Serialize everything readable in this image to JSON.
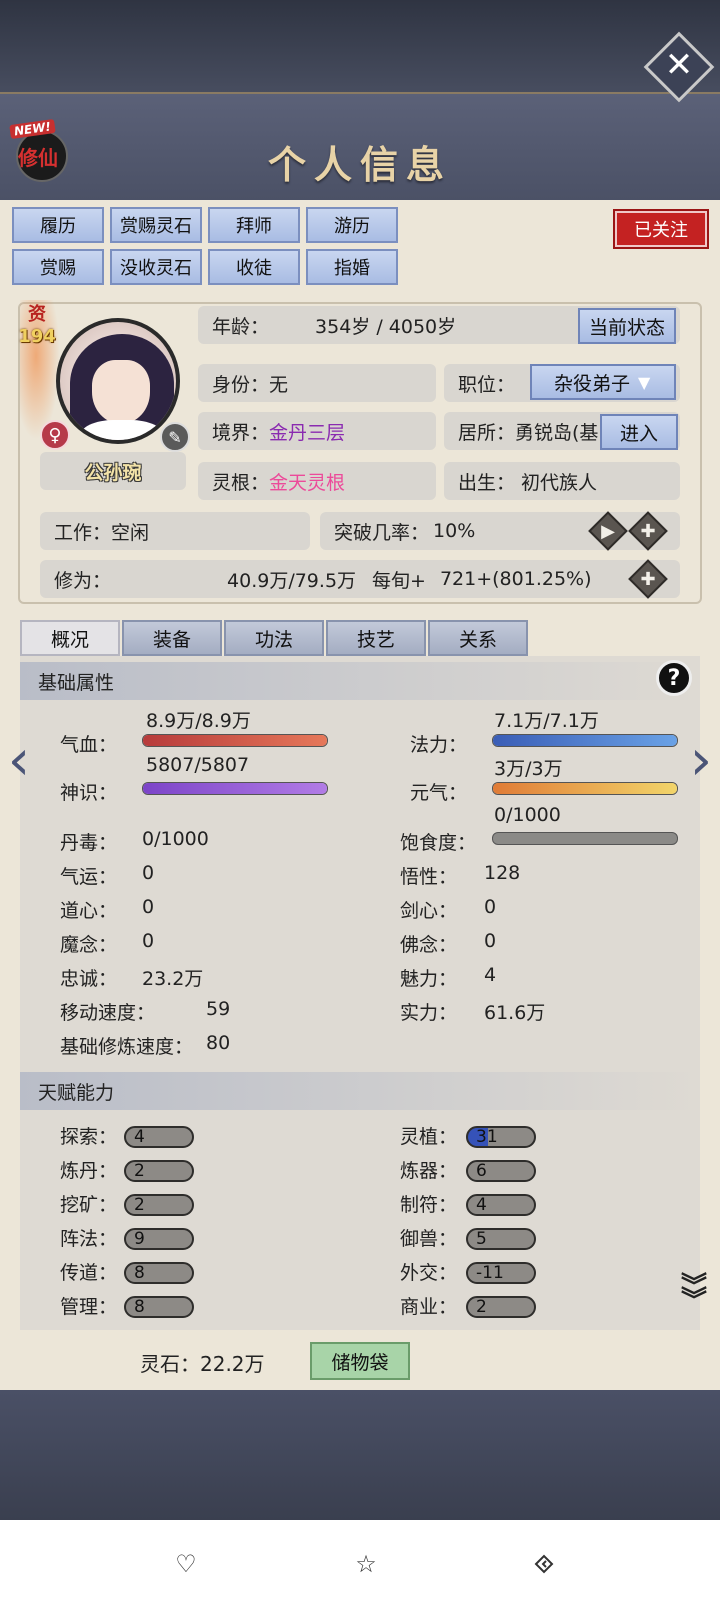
{
  "header": {
    "title": "个人信息",
    "logo_new": "NEW!",
    "logo_text": "修仙",
    "close_glyph": "✕"
  },
  "actions": {
    "row1": [
      "履历",
      "赏赐灵石",
      "拜师",
      "游历"
    ],
    "row2": [
      "赏赐",
      "没收灵石",
      "收徒",
      "指婚"
    ],
    "follow": "已关注"
  },
  "profile": {
    "aptitude_label": "资",
    "aptitude_value": "194",
    "name": "公孙琬",
    "gender_icon": "female-icon",
    "age_label": "年龄：",
    "age_value": "354岁 / 4050岁",
    "status_button": "当前状态",
    "identity_label": "身份：",
    "identity_value": "无",
    "position_label": "职位：",
    "position_value": "杂役弟子",
    "realm_label": "境界：",
    "realm_value": "金丹三层",
    "residence_label": "居所：",
    "residence_value": "勇锐岛(基",
    "enter_button": "进入",
    "root_label": "灵根：",
    "root_value": "金天灵根",
    "birth_label": "出生：",
    "birth_value": "初代族人",
    "work_label": "工作：",
    "work_value": "空闲",
    "breakthrough_label": "突破几率：",
    "breakthrough_value": "10%",
    "cultivation_label": "修为：",
    "cultivation_value": "40.9万/79.5万",
    "per_xun_label": "每旬+",
    "per_xun_value": "721+(801.25%)"
  },
  "tabs": [
    "概况",
    "装备",
    "功法",
    "技艺",
    "关系"
  ],
  "basic": {
    "title": "基础属性",
    "help": "?",
    "hp_label": "气血：",
    "hp_value": "8.9万/8.9万",
    "hp_fill": 1.0,
    "mana_label": "法力：",
    "mana_value": "7.1万/7.1万",
    "mana_fill": 1.0,
    "sense_label": "神识：",
    "sense_value": "5807/5807",
    "sense_fill": 1.0,
    "vital_label": "元气：",
    "vital_value": "3万/3万",
    "vital_fill": 1.0,
    "poison_label": "丹毒：",
    "poison_value": "0/1000",
    "satiety_label": "饱食度：",
    "satiety_value": "0/1000",
    "satiety_fill": 0.0,
    "luck_label": "气运：",
    "luck_value": "0",
    "comp_label": "悟性：",
    "comp_value": "128",
    "dao_label": "道心：",
    "dao_value": "0",
    "sword_label": "剑心：",
    "sword_value": "0",
    "demon_label": "魔念：",
    "demon_value": "0",
    "buddha_label": "佛念：",
    "buddha_value": "0",
    "loyal_label": "忠诚：",
    "loyal_value": "23.2万",
    "charm_label": "魅力：",
    "charm_value": "4",
    "move_label": "移动速度：",
    "move_value": "59",
    "power_label": "实力：",
    "power_value": "61.6万",
    "train_label": "基础修炼速度：",
    "train_value": "80"
  },
  "talent": {
    "title": "天赋能力",
    "left": [
      {
        "label": "探索：",
        "value": "4"
      },
      {
        "label": "炼丹：",
        "value": "2"
      },
      {
        "label": "挖矿：",
        "value": "2"
      },
      {
        "label": "阵法：",
        "value": "9"
      },
      {
        "label": "传道：",
        "value": "8"
      },
      {
        "label": "管理：",
        "value": "8"
      }
    ],
    "right": [
      {
        "label": "灵植：",
        "value": "31"
      },
      {
        "label": "炼器：",
        "value": "6"
      },
      {
        "label": "制符：",
        "value": "4"
      },
      {
        "label": "御兽：",
        "value": "5"
      },
      {
        "label": "外交：",
        "value": "-11"
      },
      {
        "label": "商业：",
        "value": "2"
      }
    ]
  },
  "footer": {
    "stone_label": "灵石：22.2万",
    "bag_button": "储物袋"
  },
  "colors": {
    "hp": "#d9574a",
    "mana": "#4a74c9",
    "sense": "#9a5bd8",
    "vital": "#e9a13a",
    "accent_red": "#c42222"
  }
}
